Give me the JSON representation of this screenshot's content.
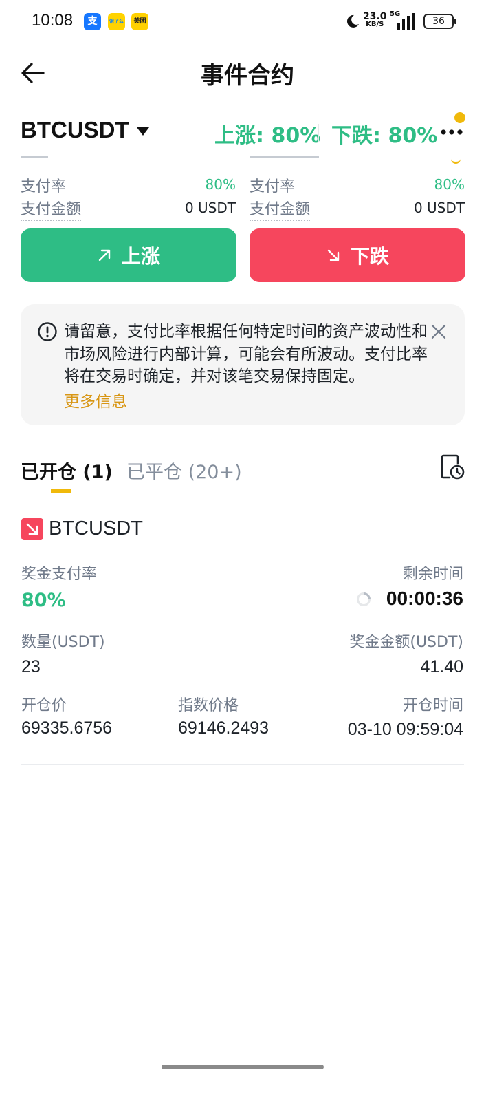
{
  "status_bar": {
    "time": "10:08",
    "apps": [
      {
        "name": "alipay",
        "label": "支",
        "bg": "#1677ff",
        "fg": "#ffffff"
      },
      {
        "name": "eleme",
        "label": "饿了么",
        "bg": "#ffd300",
        "fg": "#1e88e5"
      },
      {
        "name": "meituan",
        "label": "美团",
        "bg": "#ffd100",
        "fg": "#222222"
      }
    ],
    "net_speed": "23.0",
    "net_unit": "KB/S",
    "network": "5G",
    "battery": "36"
  },
  "header": {
    "title": "事件合约"
  },
  "symbol_bar": {
    "symbol": "BTCUSDT",
    "up_stat": "上涨: 80%",
    "down_stat": "下跌: 80%"
  },
  "up_panel": {
    "payout_rate_label": "支付率",
    "payout_rate": "80%",
    "payout_amount_label": "支付金额",
    "payout_amount": "0 USDT"
  },
  "down_panel": {
    "payout_rate_label": "支付率",
    "payout_rate": "80%",
    "payout_amount_label": "支付金额",
    "payout_amount": "0 USDT"
  },
  "buttons": {
    "up": "上涨",
    "down": "下跌"
  },
  "notice": {
    "text": "请留意，支付比率根据任何特定时间的资产波动性和市场风险进行内部计算，可能会有所波动。支付比率将在交易时确定，并对该笔交易保持固定。",
    "more": "更多信息"
  },
  "tabs": {
    "open": "已开仓 (1)",
    "closed": "已平仓 (20+)"
  },
  "position": {
    "symbol": "BTCUSDT",
    "payout_rate_label": "奖金支付率",
    "payout_rate": "80%",
    "remaining_label": "剩余时间",
    "remaining": "00:00:36",
    "qty_label": "数量(USDT)",
    "qty": "23",
    "bonus_label": "奖金金额(USDT)",
    "bonus": "41.40",
    "open_price_label": "开仓价",
    "open_price": "69335.6756",
    "index_price_label": "指数价格",
    "index_price": "69146.2493",
    "open_time_label": "开仓时间",
    "open_time": "03-10 09:59:04"
  },
  "colors": {
    "up": "#2ebd85",
    "down": "#f6465d",
    "accent": "#f0b90b",
    "link": "#d89614"
  }
}
